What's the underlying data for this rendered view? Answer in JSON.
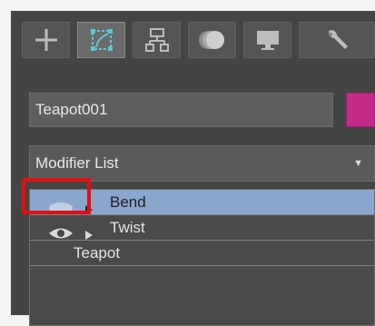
{
  "command_panel": {
    "tabs": [
      {
        "name": "create",
        "icon": "plus-icon"
      },
      {
        "name": "modify",
        "icon": "modify-icon",
        "active": true
      },
      {
        "name": "hierarchy",
        "icon": "hierarchy-icon"
      },
      {
        "name": "motion",
        "icon": "motion-icon"
      },
      {
        "name": "display",
        "icon": "display-icon"
      },
      {
        "name": "utilities",
        "icon": "wrench-icon"
      }
    ]
  },
  "object": {
    "name": "Teapot001",
    "color": "#c42a88"
  },
  "modifier_list": {
    "label": "Modifier List"
  },
  "stack": {
    "items": [
      {
        "label": "Bend",
        "selected": true,
        "visible": false
      },
      {
        "label": "Twist",
        "selected": false,
        "visible": true
      },
      {
        "label": "Teapot",
        "base": true
      }
    ]
  }
}
